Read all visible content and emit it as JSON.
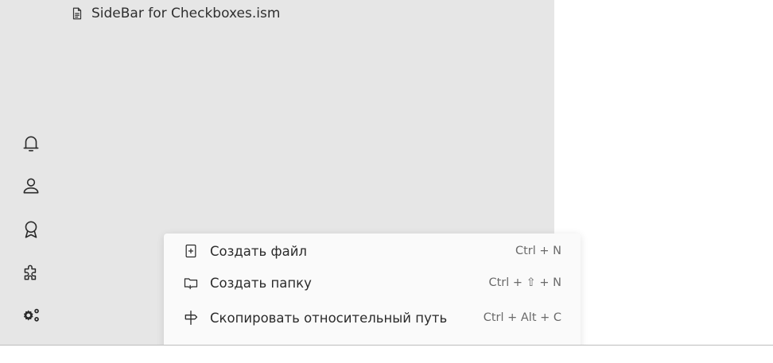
{
  "sidebar": {
    "tree_item": {
      "label": "SideBar for Checkboxes.ism",
      "icon": "file-text-icon"
    },
    "rail": [
      {
        "name": "bell-icon"
      },
      {
        "name": "user-icon"
      },
      {
        "name": "badge-icon"
      },
      {
        "name": "puzzle-icon"
      },
      {
        "name": "gears-icon"
      }
    ]
  },
  "context_menu": {
    "items": [
      {
        "label": "Создать файл",
        "shortcut": "Ctrl + N",
        "icon": "new-file-icon"
      },
      {
        "label": "Создать папку",
        "shortcut": "Ctrl + ⇧ + N",
        "icon": "new-folder-icon"
      },
      {
        "label": "Скопировать относительный путь",
        "shortcut": "Ctrl + Alt + C",
        "icon": "signpost-icon"
      }
    ]
  },
  "colors": {
    "sidebar_bg": "#e6e6e6",
    "menu_bg": "#fafafa",
    "text": "#2b2b2b",
    "shortcut": "#6a6a6a"
  }
}
